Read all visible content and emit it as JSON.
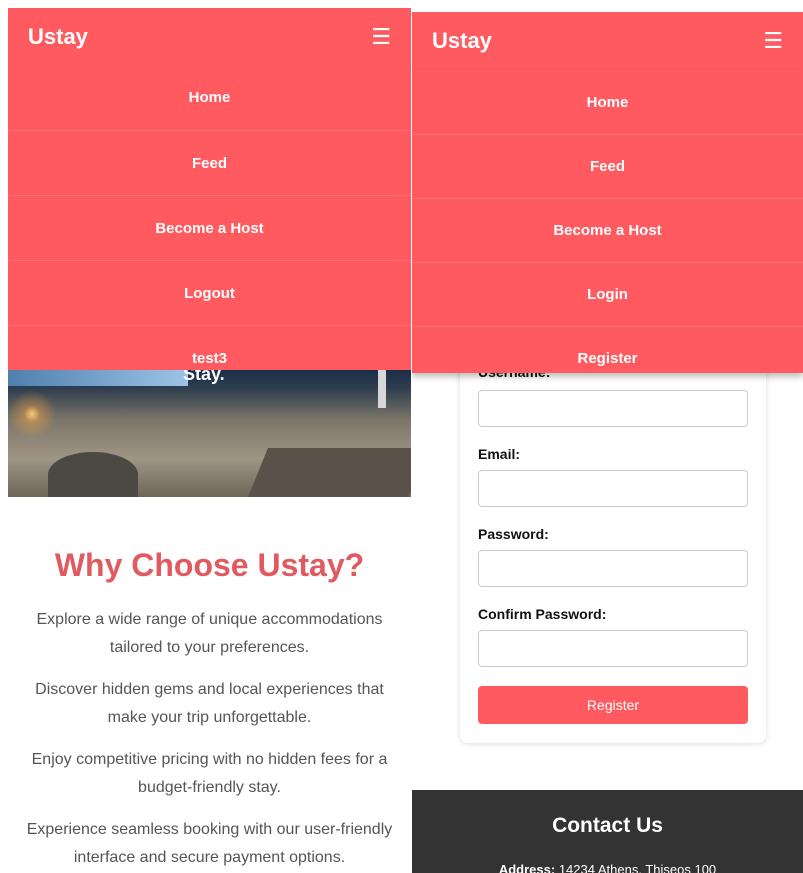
{
  "brand": "Ustay",
  "left": {
    "menu": [
      "Home",
      "Feed",
      "Become a Host",
      "Logout",
      "test3"
    ],
    "hero_partial_text": "Stay.",
    "why": {
      "title": "Why Choose Ustay?",
      "points": [
        "Explore a wide range of unique accommodations tailored to your preferences.",
        "Discover hidden gems and local experiences that make your trip unforgettable.",
        "Enjoy competitive pricing with no hidden fees for a budget-friendly stay.",
        "Experience seamless booking with our user-friendly interface and secure payment options."
      ]
    }
  },
  "right": {
    "menu": [
      "Home",
      "Feed",
      "Become a Host",
      "Login",
      "Register"
    ],
    "form": {
      "username_label": "Username:",
      "email_label": "Email:",
      "password_label": "Password:",
      "confirm_label": "Confirm Password:",
      "submit": "Register"
    },
    "footer": {
      "title": "Contact Us",
      "address_label": "Address:",
      "address_value": "14234 Athens, Thiseos 100"
    }
  },
  "colors": {
    "accent": "#ff5a5f",
    "heading": "#e05a60",
    "footer_bg": "#333333"
  }
}
